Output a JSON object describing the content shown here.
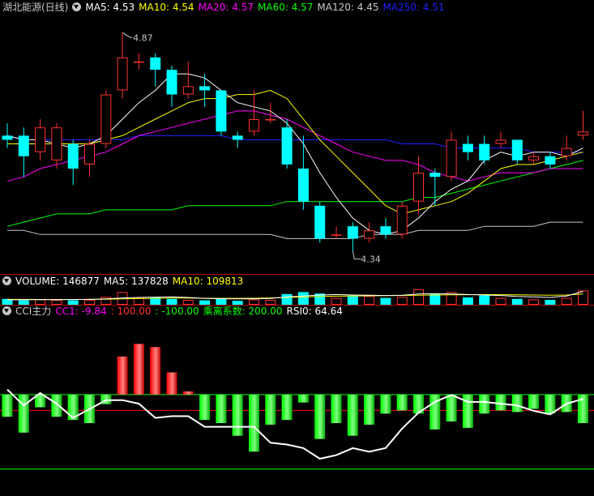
{
  "header": {
    "stock_name": "湖北能源(日线)",
    "ma_labels": [
      {
        "text": "MA5: 4.53",
        "color": "#ffffff"
      },
      {
        "text": "MA10: 4.54",
        "color": "#ffff00"
      },
      {
        "text": "MA20: 4.57",
        "color": "#ff00ff"
      },
      {
        "text": "MA60: 4.57",
        "color": "#00ff00"
      },
      {
        "text": "MA120: 4.45",
        "color": "#c8c8c8"
      },
      {
        "text": "MA250: 4.51",
        "color": "#2020ff"
      }
    ]
  },
  "volume_header": {
    "volume": "VOLUME: 146877",
    "ma5": "MA5: 137828",
    "ma10": "MA10: 109813"
  },
  "cci_header": {
    "name": "CCI主力",
    "cc1": "CC1: -9.84",
    "up": ": 100.00",
    "down": ": -100.00",
    "coef": "乘离系数: 200.00",
    "rsi": "RSI0: 64.64"
  },
  "colors": {
    "up": "#ff3232",
    "down": "#00ffff",
    "ma5": "#ffffff",
    "ma10": "#ffff00",
    "ma20": "#ff00ff",
    "ma60": "#00ff00",
    "ma120": "#c8c8c8",
    "ma250": "#2020ff",
    "cci_pos": "#ff0000",
    "cci_neg": "#00ff00",
    "fill": "#ffff00"
  },
  "chart_data": [
    {
      "type": "candlestick",
      "panel": "price",
      "annotations": [
        {
          "label": "4.87",
          "at_index": 7,
          "kind": "high"
        },
        {
          "label": "4.34",
          "at_index": 21,
          "kind": "low"
        }
      ],
      "ylim": [
        4.3,
        4.91
      ],
      "candles": [
        {
          "o": 4.62,
          "c": 4.61,
          "h": 4.65,
          "l": 4.59
        },
        {
          "o": 4.62,
          "c": 4.57,
          "h": 4.64,
          "l": 4.52
        },
        {
          "o": 4.58,
          "c": 4.64,
          "h": 4.66,
          "l": 4.56
        },
        {
          "o": 4.56,
          "c": 4.64,
          "h": 4.65,
          "l": 4.54
        },
        {
          "o": 4.6,
          "c": 4.54,
          "h": 4.61,
          "l": 4.5
        },
        {
          "o": 4.55,
          "c": 4.6,
          "h": 4.61,
          "l": 4.52
        },
        {
          "o": 4.6,
          "c": 4.72,
          "h": 4.73,
          "l": 4.59
        },
        {
          "o": 4.73,
          "c": 4.81,
          "h": 4.87,
          "l": 4.71
        },
        {
          "o": 4.8,
          "c": 4.8,
          "h": 4.82,
          "l": 4.78
        },
        {
          "o": 4.81,
          "c": 4.78,
          "h": 4.82,
          "l": 4.74
        },
        {
          "o": 4.78,
          "c": 4.72,
          "h": 4.79,
          "l": 4.69
        },
        {
          "o": 4.72,
          "c": 4.74,
          "h": 4.8,
          "l": 4.71
        },
        {
          "o": 4.74,
          "c": 4.73,
          "h": 4.77,
          "l": 4.69
        },
        {
          "o": 4.73,
          "c": 4.63,
          "h": 4.73,
          "l": 4.62
        },
        {
          "o": 4.62,
          "c": 4.61,
          "h": 4.63,
          "l": 4.59
        },
        {
          "o": 4.63,
          "c": 4.66,
          "h": 4.73,
          "l": 4.62
        },
        {
          "o": 4.66,
          "c": 4.66,
          "h": 4.7,
          "l": 4.65
        },
        {
          "o": 4.64,
          "c": 4.55,
          "h": 4.66,
          "l": 4.54
        },
        {
          "o": 4.54,
          "c": 4.46,
          "h": 4.62,
          "l": 4.44
        },
        {
          "o": 4.45,
          "c": 4.37,
          "h": 4.46,
          "l": 4.36
        },
        {
          "o": 4.38,
          "c": 4.38,
          "h": 4.4,
          "l": 4.37
        },
        {
          "o": 4.4,
          "c": 4.37,
          "h": 4.41,
          "l": 4.34
        },
        {
          "o": 4.37,
          "c": 4.39,
          "h": 4.41,
          "l": 4.36
        },
        {
          "o": 4.4,
          "c": 4.38,
          "h": 4.42,
          "l": 4.37
        },
        {
          "o": 4.38,
          "c": 4.45,
          "h": 4.46,
          "l": 4.37
        },
        {
          "o": 4.46,
          "c": 4.53,
          "h": 4.57,
          "l": 4.43
        },
        {
          "o": 4.53,
          "c": 4.52,
          "h": 4.54,
          "l": 4.45
        },
        {
          "o": 4.52,
          "c": 4.61,
          "h": 4.63,
          "l": 4.51
        },
        {
          "o": 4.6,
          "c": 4.58,
          "h": 4.62,
          "l": 4.56
        },
        {
          "o": 4.6,
          "c": 4.56,
          "h": 4.62,
          "l": 4.55
        },
        {
          "o": 4.6,
          "c": 4.61,
          "h": 4.63,
          "l": 4.59
        },
        {
          "o": 4.61,
          "c": 4.56,
          "h": 4.61,
          "l": 4.55
        },
        {
          "o": 4.56,
          "c": 4.57,
          "h": 4.58,
          "l": 4.55
        },
        {
          "o": 4.57,
          "c": 4.55,
          "h": 4.58,
          "l": 4.54
        },
        {
          "o": 4.57,
          "c": 4.59,
          "h": 4.62,
          "l": 4.56
        },
        {
          "o": 4.62,
          "c": 4.63,
          "h": 4.68,
          "l": 4.61
        }
      ],
      "ma_lines": {
        "ma5": [
          4.62,
          4.61,
          4.61,
          4.6,
          4.59,
          4.6,
          4.62,
          4.66,
          4.7,
          4.73,
          4.77,
          4.77,
          4.76,
          4.73,
          4.7,
          4.69,
          4.68,
          4.65,
          4.6,
          4.53,
          4.47,
          4.42,
          4.39,
          4.38,
          4.39,
          4.42,
          4.46,
          4.49,
          4.51,
          4.56,
          4.58,
          4.57,
          4.58,
          4.58,
          4.57,
          4.59
        ],
        "ma10": [
          4.6,
          4.6,
          4.6,
          4.6,
          4.6,
          4.6,
          4.61,
          4.62,
          4.64,
          4.66,
          4.68,
          4.7,
          4.71,
          4.71,
          4.72,
          4.72,
          4.73,
          4.71,
          4.66,
          4.61,
          4.57,
          4.53,
          4.49,
          4.45,
          4.43,
          4.44,
          4.45,
          4.46,
          4.48,
          4.51,
          4.54,
          4.55,
          4.55,
          4.56,
          4.57,
          4.58
        ],
        "ma20": [
          4.51,
          4.52,
          4.54,
          4.55,
          4.56,
          4.57,
          4.58,
          4.6,
          4.62,
          4.63,
          4.64,
          4.65,
          4.66,
          4.67,
          4.68,
          4.68,
          4.67,
          4.66,
          4.64,
          4.62,
          4.6,
          4.58,
          4.57,
          4.56,
          4.56,
          4.55,
          4.53,
          4.52,
          4.51,
          4.52,
          4.53,
          4.53,
          4.53,
          4.54,
          4.54,
          4.54
        ],
        "ma60": [
          4.4,
          4.41,
          4.42,
          4.43,
          4.43,
          4.43,
          4.44,
          4.44,
          4.44,
          4.44,
          4.44,
          4.45,
          4.45,
          4.45,
          4.45,
          4.45,
          4.45,
          4.46,
          4.46,
          4.46,
          4.46,
          4.46,
          4.46,
          4.46,
          4.46,
          4.47,
          4.47,
          4.48,
          4.49,
          4.5,
          4.51,
          4.52,
          4.53,
          4.54,
          4.55,
          4.56
        ],
        "ma120": [
          4.39,
          4.39,
          4.38,
          4.38,
          4.38,
          4.38,
          4.38,
          4.38,
          4.38,
          4.38,
          4.38,
          4.38,
          4.38,
          4.38,
          4.38,
          4.38,
          4.38,
          4.37,
          4.37,
          4.37,
          4.37,
          4.37,
          4.38,
          4.38,
          4.38,
          4.39,
          4.39,
          4.39,
          4.39,
          4.4,
          4.4,
          4.4,
          4.4,
          4.41,
          4.41,
          4.41
        ],
        "ma250": [
          4.62,
          4.61,
          4.61,
          4.61,
          4.61,
          4.61,
          4.61,
          4.61,
          4.62,
          4.62,
          4.62,
          4.62,
          4.62,
          4.62,
          4.61,
          4.61,
          4.61,
          4.61,
          4.61,
          4.61,
          4.61,
          4.61,
          4.61,
          4.61,
          4.6,
          4.6,
          4.6,
          4.59,
          4.59,
          4.59,
          4.59,
          4.59,
          4.58,
          4.58,
          4.58,
          4.58
        ]
      }
    },
    {
      "type": "bar",
      "panel": "volume",
      "ylim": [
        0,
        200000
      ],
      "values": [
        60000,
        45000,
        55000,
        50000,
        45000,
        50000,
        80000,
        130000,
        70000,
        75000,
        60000,
        50000,
        45000,
        65000,
        40000,
        55000,
        50000,
        110000,
        130000,
        115000,
        70000,
        95000,
        90000,
        70000,
        80000,
        160000,
        110000,
        130000,
        75000,
        95000,
        70000,
        60000,
        55000,
        50000,
        70000,
        146877
      ],
      "ma5": [
        50000,
        51000,
        52000,
        52000,
        53000,
        55000,
        60000,
        70000,
        75000,
        78000,
        80000,
        75000,
        65000,
        62000,
        60000,
        60000,
        65000,
        80000,
        90000,
        100000,
        105000,
        100000,
        98000,
        95000,
        98000,
        110000,
        115000,
        110000,
        105000,
        100000,
        95000,
        85000,
        80000,
        75000,
        90000,
        137828
      ],
      "ma10": [
        55000,
        55000,
        54000,
        54000,
        54000,
        55000,
        57000,
        60000,
        63000,
        66000,
        68000,
        68000,
        67000,
        66000,
        66000,
        67000,
        70000,
        75000,
        80000,
        85000,
        88000,
        90000,
        92000,
        93000,
        95000,
        98000,
        100000,
        102000,
        103000,
        104000,
        103000,
        102000,
        100000,
        98000,
        100000,
        109813
      ]
    },
    {
      "type": "bar",
      "panel": "cci",
      "ylim": [
        -320,
        240
      ],
      "values": [
        -70,
        -120,
        -40,
        -70,
        -80,
        -90,
        -30,
        120,
        160,
        150,
        70,
        10,
        -80,
        -90,
        -130,
        -180,
        -95,
        -80,
        -25,
        -140,
        -90,
        -130,
        -95,
        -60,
        -50,
        -60,
        -110,
        -85,
        -105,
        -60,
        -50,
        -55,
        -45,
        -60,
        -55,
        -90
      ],
      "rsi0_line": [
        0.6,
        0.51,
        0.58,
        0.52,
        0.44,
        0.49,
        0.54,
        0.54,
        0.52,
        0.44,
        0.45,
        0.45,
        0.39,
        0.39,
        0.39,
        0.39,
        0.3,
        0.29,
        0.27,
        0.21,
        0.23,
        0.27,
        0.25,
        0.27,
        0.38,
        0.47,
        0.53,
        0.57,
        0.53,
        0.53,
        0.52,
        0.51,
        0.48,
        0.46,
        0.52,
        0.5464
      ]
    }
  ]
}
